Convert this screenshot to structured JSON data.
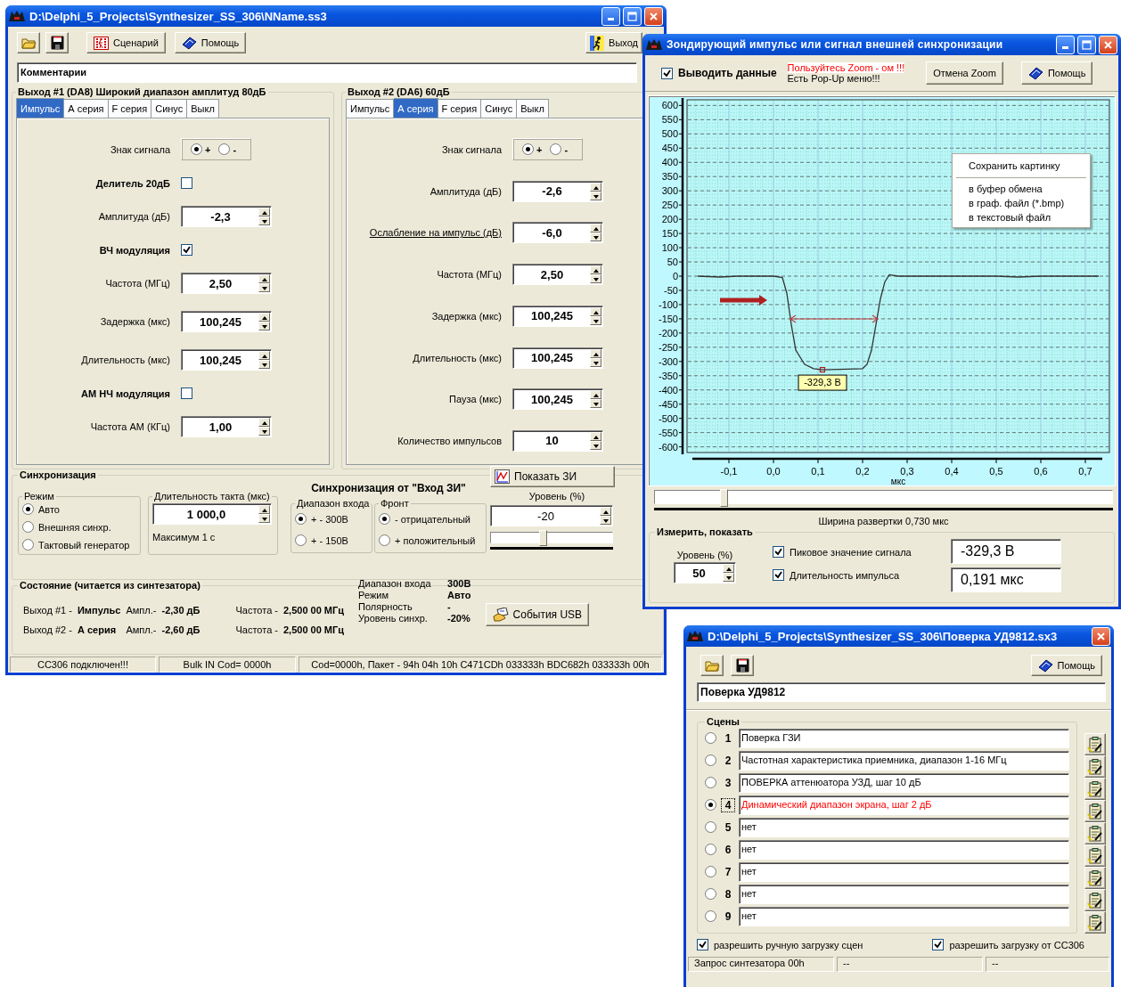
{
  "main_window": {
    "title": "D:\\Delphi_5_Projects\\Synthesizer_SS_306\\NName.ss3",
    "toolbar": [
      {
        "kind": "open"
      },
      {
        "kind": "save"
      },
      {
        "kind": "scenario",
        "label": "Сценарий"
      },
      {
        "kind": "help",
        "label": "Помощь"
      },
      {
        "kind": "exit",
        "label": "Выход"
      }
    ],
    "comment": {
      "value": "Комментарии"
    },
    "outputs": [
      {
        "title": "Выход #1 (DA8) Широкий диапазон амплитуд 80дБ",
        "tabs": [
          {
            "label": "Импульс",
            "selected": true
          },
          {
            "label": "А серия",
            "selected": false
          },
          {
            "label": "F серия",
            "selected": false
          },
          {
            "label": "Синус",
            "selected": false
          },
          {
            "label": "Выкл",
            "selected": false
          }
        ],
        "rows": [
          {
            "kind": "sign",
            "label": "Знак сигнала",
            "options": [
              {
                "label": "+",
                "selected": true
              },
              {
                "label": "-",
                "selected": false
              }
            ]
          },
          {
            "kind": "checkbox",
            "label": "Делитель 20дБ",
            "checked": false
          },
          {
            "kind": "spin",
            "label": "Амплитуда (дБ)",
            "value": "-2,3"
          },
          {
            "kind": "checkbox",
            "label": "ВЧ модуляция",
            "checked": true
          },
          {
            "kind": "spin",
            "label": "Частота (МГц)",
            "value": "2,50"
          },
          {
            "kind": "spin",
            "label": "Задержка (мкс)",
            "value": "100,245"
          },
          {
            "kind": "spin",
            "label": "Длительность (мкс)",
            "value": "100,245"
          },
          {
            "kind": "checkbox",
            "label": "АМ НЧ модуляция",
            "checked": false
          },
          {
            "kind": "spin",
            "label": "Частота АМ (КГц)",
            "value": "1,00"
          }
        ]
      },
      {
        "title": "Выход #2 (DA6) 60дБ",
        "tabs": [
          {
            "label": "Импульс",
            "selected": false
          },
          {
            "label": "А серия",
            "selected": true
          },
          {
            "label": "F серия",
            "selected": false
          },
          {
            "label": "Синус",
            "selected": false
          },
          {
            "label": "Выкл",
            "selected": false
          }
        ],
        "rows": [
          {
            "kind": "sign",
            "label": "Знак сигнала",
            "underlined": false,
            "options": [
              {
                "label": "+",
                "selected": true
              },
              {
                "label": "-",
                "selected": false
              }
            ]
          },
          {
            "kind": "spin",
            "label": "Амплитуда (дБ)",
            "value": "-2,6",
            "underlined": false
          },
          {
            "kind": "spin",
            "label": "Ослабление на импульс (дБ)",
            "value": "-6,0",
            "underlined": true
          },
          {
            "kind": "spin",
            "label": "Частота (МГц)",
            "value": "2,50",
            "underlined": false
          },
          {
            "kind": "spin",
            "label": "Задержка (мкс)",
            "value": "100,245",
            "underlined": false
          },
          {
            "kind": "spin",
            "label": "Длительность (мкс)",
            "value": "100,245",
            "underlined": false
          },
          {
            "kind": "spin",
            "label": "Пауза (мкс)",
            "value": "100,245",
            "underlined": false
          },
          {
            "kind": "spin",
            "label": "Количество импульсов",
            "value": "10",
            "underlined": false
          }
        ]
      }
    ],
    "sync": {
      "title": "Синхронизация",
      "mode": {
        "title": "Режим",
        "options": [
          {
            "label": "Авто",
            "selected": true
          },
          {
            "label": "Внешняя синхр.",
            "selected": false
          },
          {
            "label": "Тактовый генератор",
            "selected": false
          }
        ]
      },
      "clock": {
        "title": "Длительность такта (мкс)",
        "value": "1 000,0",
        "note": "Максимум 1 с"
      },
      "external_title": "Синхронизация от \"Вход ЗИ\"",
      "range": {
        "title": "Диапазон входа",
        "options": [
          {
            "label": "+ - 300В",
            "selected": true
          },
          {
            "label": "+ - 150В",
            "selected": false
          }
        ]
      },
      "edge": {
        "title": "Фронт",
        "options": [
          {
            "label": "- отрицательный",
            "selected": true
          },
          {
            "label": "+ положительный",
            "selected": false
          }
        ]
      },
      "show_button": "Показать ЗИ",
      "level_label": "Уровень (%)",
      "level_value": "-20",
      "slider": {
        "level": 0.43
      }
    },
    "state": {
      "title": "Состояние (читается из синтезатора)",
      "outputs": [
        {
          "label": "Выход #1 -",
          "mode": "Импульс",
          "ampl_label": "Ампл.-",
          "ampl": "-2,30 дБ",
          "freq_label": "Частота -",
          "freq": "2,500 00 МГц"
        },
        {
          "label": "Выход #2 -",
          "mode": "А серия",
          "ampl_label": "Ампл.-",
          "ampl": "-2,60 дБ",
          "freq_label": "Частота -",
          "freq": "2,500 00 МГц"
        }
      ],
      "params": [
        {
          "label": "Диапазон входа",
          "value": "300В"
        },
        {
          "label": "Режим",
          "value": "Авто"
        },
        {
          "label": "Полярность",
          "value": "-"
        },
        {
          "label": "Уровень синхр.",
          "value": "-20%"
        }
      ],
      "usb_button": "События USB"
    },
    "status_bar": [
      "СС306 подключен!!!",
      "Bulk IN Cod= 0000h",
      "Cod=0000h, Пакет - 94h 04h 10h C471CDh 033333h BDC682h 033333h 00h"
    ]
  },
  "scope_window": {
    "title": "Зондирующий импульс или сигнал внешней синхронизации",
    "show_data": {
      "label": "Выводить данные",
      "checked": true
    },
    "hints": [
      {
        "text": "Пользуйтесь Zoom - ом !!!",
        "color": "#ff0000"
      },
      {
        "text": "Есть Pop-Up меню!!!",
        "color": "#000000"
      }
    ],
    "buttons": [
      {
        "kind": "cancel_zoom",
        "label": "Отмена Zoom"
      },
      {
        "kind": "help",
        "label": "Помощь"
      }
    ],
    "chart_data": {
      "type": "line",
      "grid": true,
      "xlabel": "мкс",
      "xlim": [
        -0.194,
        0.754
      ],
      "ylim": [
        -620,
        620
      ],
      "x": [
        -0.17,
        -0.12,
        -0.08,
        0,
        0.02,
        0.03,
        0.04,
        0.05,
        0.07,
        0.09,
        0.11,
        0.15,
        0.2,
        0.21,
        0.22,
        0.23,
        0.24,
        0.25,
        0.26,
        0.28,
        0.3,
        0.5,
        0.55,
        0.6,
        0.73
      ],
      "series": [
        {
          "color": "#333333",
          "values": [
            0,
            -3,
            0,
            0,
            -5,
            -60,
            -170,
            -260,
            -310,
            -325,
            -329,
            -328,
            -325,
            -310,
            -260,
            -170,
            -80,
            -20,
            5,
            0,
            0,
            0,
            -3,
            0,
            0
          ]
        }
      ],
      "xticks": [
        {
          "value": -0.1,
          "label": "-0,1"
        },
        {
          "value": 0,
          "label": "0,0"
        },
        {
          "value": 0.1,
          "label": "0,1"
        },
        {
          "value": 0.2,
          "label": "0,2"
        },
        {
          "value": 0.3,
          "label": "0,3"
        },
        {
          "value": 0.4,
          "label": "0,4"
        },
        {
          "value": 0.5,
          "label": "0,5"
        },
        {
          "value": 0.6,
          "label": "0,6"
        },
        {
          "value": 0.7,
          "label": "0,7"
        }
      ],
      "yticks": [
        600,
        550,
        500,
        450,
        400,
        350,
        300,
        250,
        200,
        150,
        100,
        50,
        0,
        -50,
        -100,
        -150,
        -200,
        -250,
        -300,
        -350,
        -400,
        -450,
        -500,
        -550,
        -600
      ],
      "annotations": [
        {
          "x": 0.11,
          "y": -329,
          "text": "-329,3 В"
        }
      ]
    },
    "context_menu": {
      "title": "Сохранить картинку",
      "items": [
        "в буфер обмена",
        "в граф. файл (*.bmp)",
        "в текстовый файл"
      ]
    },
    "sweep": {
      "level": 0.15,
      "caption": "Ширина развертки 0,730 мкс"
    },
    "measure": {
      "title": "Измерить, показать",
      "level_label": "Уровень (%)",
      "level_value": "50",
      "checks": [
        {
          "label": "Пиковое значение сигнала",
          "checked": true,
          "value": "-329,3 В"
        },
        {
          "label": "Длительность импульса",
          "checked": true,
          "value": "0,191 мкс"
        }
      ]
    }
  },
  "scenes_window": {
    "title": "D:\\Delphi_5_Projects\\Synthesizer_SS_306\\Поверка УД9812.sx3",
    "toolbar": [
      {
        "kind": "open"
      },
      {
        "kind": "save"
      },
      {
        "kind": "help",
        "label": "Помощь"
      }
    ],
    "name": "Поверка УД9812",
    "group_title": "Сцены",
    "scenes": [
      {
        "number": "1",
        "text": "Поверка ГЗИ",
        "selected": false
      },
      {
        "number": "2",
        "text": "Частотная характеристика приемника, диапазон 1-16 МГц",
        "selected": false
      },
      {
        "number": "3",
        "text": "ПОВЕРКА аттенюатора УЗД, шаг 10 дБ",
        "selected": false
      },
      {
        "number": "4",
        "text": "Динамический диапазон экрана, шаг 2 дБ",
        "selected": true
      },
      {
        "number": "5",
        "text": "нет",
        "selected": false
      },
      {
        "number": "6",
        "text": "нет",
        "selected": false
      },
      {
        "number": "7",
        "text": "нет",
        "selected": false
      },
      {
        "number": "8",
        "text": "нет",
        "selected": false
      },
      {
        "number": "9",
        "text": "нет",
        "selected": false
      }
    ],
    "options": [
      {
        "label": "разрешить ручную загрузку сцен",
        "checked": true
      },
      {
        "label": "разрешить загрузку от СС306",
        "checked": true
      }
    ],
    "status_bar": [
      "Запрос синтезатора 00h",
      "--",
      "--"
    ]
  }
}
